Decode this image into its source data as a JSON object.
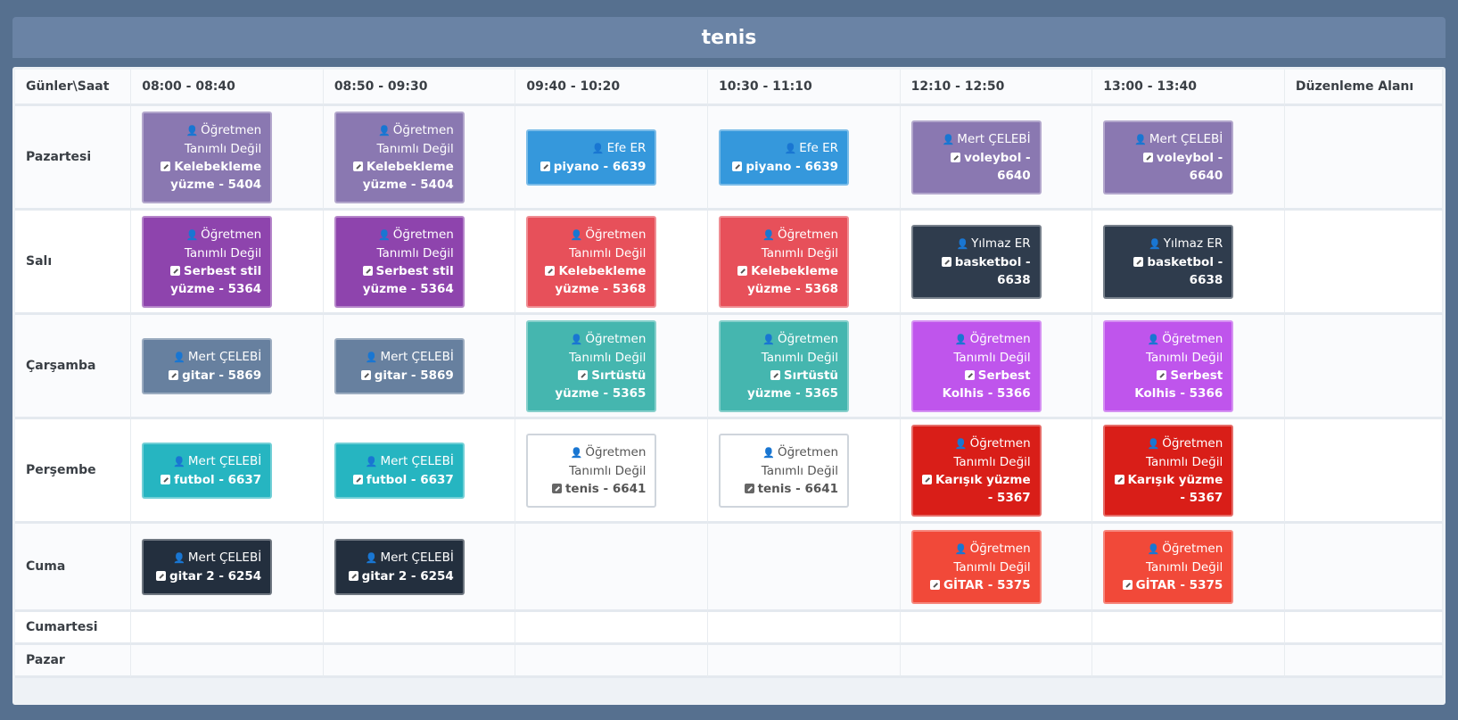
{
  "title": "tenis",
  "headers": [
    "Günler\\Saat",
    "08:00 - 08:40",
    "08:50 - 09:30",
    "09:40 - 10:20",
    "10:30 - 11:10",
    "12:10 - 12:50",
    "13:00 - 13:40",
    "Düzenleme Alanı"
  ],
  "colors": {
    "purple_gray": "#8a78b1",
    "blue": "#3598dc",
    "violet": "#8e44ad",
    "red": "#e7505a",
    "navy": "#2f3c4d",
    "slate": "#67809f",
    "teal": "#45b6af",
    "magenta": "#bf55ec",
    "cyan": "#26b5c1",
    "crimson": "#d91e18",
    "orange_red": "#f14939",
    "dark": "#232f3e"
  },
  "rows": [
    {
      "day": "Pazartesi",
      "height": 118,
      "cells": [
        {
          "teacher": "Öğretmen Tanımlı Değil",
          "lesson": "Kelebekleme yüzme - 5404",
          "color": "#8a78b1"
        },
        {
          "teacher": "Öğretmen Tanımlı Değil",
          "lesson": "Kelebekleme yüzme - 5404",
          "color": "#8a78b1"
        },
        {
          "teacher": "Efe ER",
          "lesson": "piyano - 6639",
          "color": "#3598dc"
        },
        {
          "teacher": "Efe ER",
          "lesson": "piyano - 6639",
          "color": "#3598dc"
        },
        {
          "teacher": "Mert ÇELEBİ",
          "lesson": "voleybol - 6640",
          "color": "#8a78b1"
        },
        {
          "teacher": "Mert ÇELEBİ",
          "lesson": "voleybol - 6640",
          "color": "#8a78b1"
        },
        null
      ]
    },
    {
      "day": "Salı",
      "height": 118,
      "cells": [
        {
          "teacher": "Öğretmen Tanımlı Değil",
          "lesson": "Serbest stil yüzme - 5364",
          "color": "#8e44ad"
        },
        {
          "teacher": "Öğretmen Tanımlı Değil",
          "lesson": "Serbest stil yüzme - 5364",
          "color": "#8e44ad"
        },
        {
          "teacher": "Öğretmen Tanımlı Değil",
          "lesson": "Kelebekleme yüzme - 5368",
          "color": "#e7505a"
        },
        {
          "teacher": "Öğretmen Tanımlı Değil",
          "lesson": "Kelebekleme yüzme - 5368",
          "color": "#e7505a"
        },
        {
          "teacher": "Yılmaz ER",
          "lesson": "basketbol - 6638",
          "color": "#2f3c4d"
        },
        {
          "teacher": "Yılmaz ER",
          "lesson": "basketbol - 6638",
          "color": "#2f3c4d"
        },
        null
      ]
    },
    {
      "day": "Çarşamba",
      "height": 118,
      "cells": [
        {
          "teacher": "Mert ÇELEBİ",
          "lesson": "gitar - 5869",
          "color": "#67809f"
        },
        {
          "teacher": "Mert ÇELEBİ",
          "lesson": "gitar - 5869",
          "color": "#67809f"
        },
        {
          "teacher": "Öğretmen Tanımlı Değil",
          "lesson": "Sırtüstü yüzme - 5365",
          "color": "#45b6af"
        },
        {
          "teacher": "Öğretmen Tanımlı Değil",
          "lesson": "Sırtüstü yüzme - 5365",
          "color": "#45b6af"
        },
        {
          "teacher": "Öğretmen Tanımlı Değil",
          "lesson": "Serbest Kolhis - 5366",
          "color": "#bf55ec"
        },
        {
          "teacher": "Öğretmen Tanımlı Değil",
          "lesson": "Serbest Kolhis - 5366",
          "color": "#bf55ec"
        },
        null
      ]
    },
    {
      "day": "Perşembe",
      "height": 118,
      "cells": [
        {
          "teacher": "Mert ÇELEBİ",
          "lesson": "futbol - 6637",
          "color": "#26b5c1"
        },
        {
          "teacher": "Mert ÇELEBİ",
          "lesson": "futbol - 6637",
          "color": "#26b5c1"
        },
        {
          "teacher": "Öğretmen Tanımlı Değil",
          "lesson": "tenis - 6641",
          "color": "white"
        },
        {
          "teacher": "Öğretmen Tanımlı Değil",
          "lesson": "tenis - 6641",
          "color": "white"
        },
        {
          "teacher": "Öğretmen Tanımlı Değil",
          "lesson": "Karışık yüzme - 5367",
          "color": "#d91e18"
        },
        {
          "teacher": "Öğretmen Tanımlı Değil",
          "lesson": "Karışık yüzme - 5367",
          "color": "#d91e18"
        },
        null
      ]
    },
    {
      "day": "Cuma",
      "height": 98,
      "cells": [
        {
          "teacher": "Mert ÇELEBİ",
          "lesson": "gitar 2 - 6254",
          "color": "#232f3e"
        },
        {
          "teacher": "Mert ÇELEBİ",
          "lesson": "gitar 2 - 6254",
          "color": "#232f3e"
        },
        null,
        null,
        {
          "teacher": "Öğretmen Tanımlı Değil",
          "lesson": "GİTAR - 5375",
          "color": "#f14939"
        },
        {
          "teacher": "Öğretmen Tanımlı Değil",
          "lesson": "GİTAR - 5375",
          "color": "#f14939"
        },
        null
      ]
    },
    {
      "day": "Cumartesi",
      "height": 37,
      "cells": [
        null,
        null,
        null,
        null,
        null,
        null,
        null
      ]
    },
    {
      "day": "Pazar",
      "height": 37,
      "cells": [
        null,
        null,
        null,
        null,
        null,
        null,
        null
      ]
    }
  ]
}
